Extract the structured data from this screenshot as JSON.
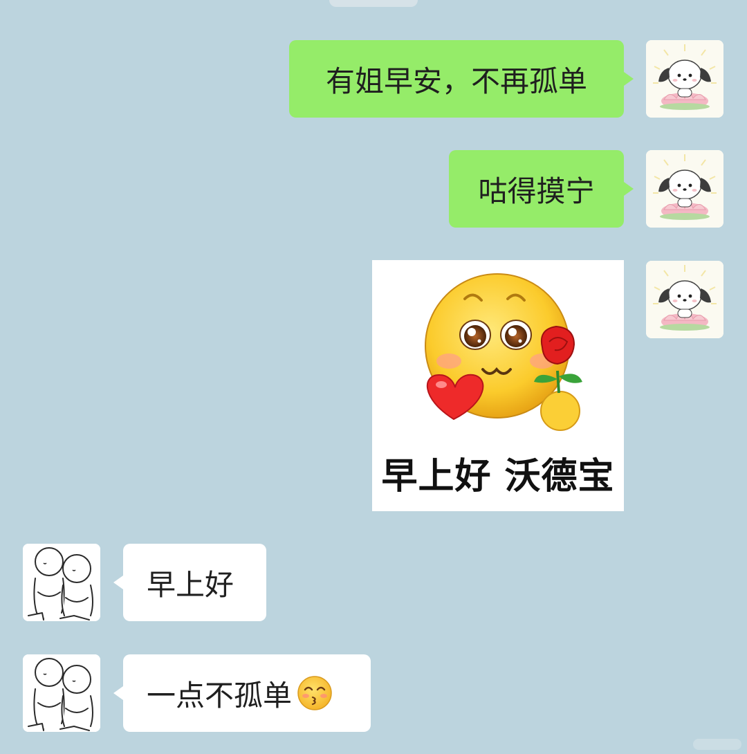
{
  "messages": [
    {
      "side": "right",
      "type": "text",
      "text": "有姐早安，不再孤单"
    },
    {
      "side": "right",
      "type": "text",
      "text": "咕得摸宁"
    },
    {
      "side": "right",
      "type": "sticker",
      "caption": "早上好 沃德宝",
      "icon": "smiley-heart-rose-sticker"
    },
    {
      "side": "left",
      "type": "text",
      "text": "早上好"
    },
    {
      "side": "left",
      "type": "text",
      "text": "一点不孤单",
      "trailing_emoji": "kissing-smile-emoji"
    }
  ],
  "colors": {
    "background": "#bcd4de",
    "outgoing_bubble": "#95ec69",
    "incoming_bubble": "#ffffff"
  },
  "avatars": {
    "self": "puppy-on-lotus-avatar",
    "other": "two-sketch-figures-avatar"
  }
}
